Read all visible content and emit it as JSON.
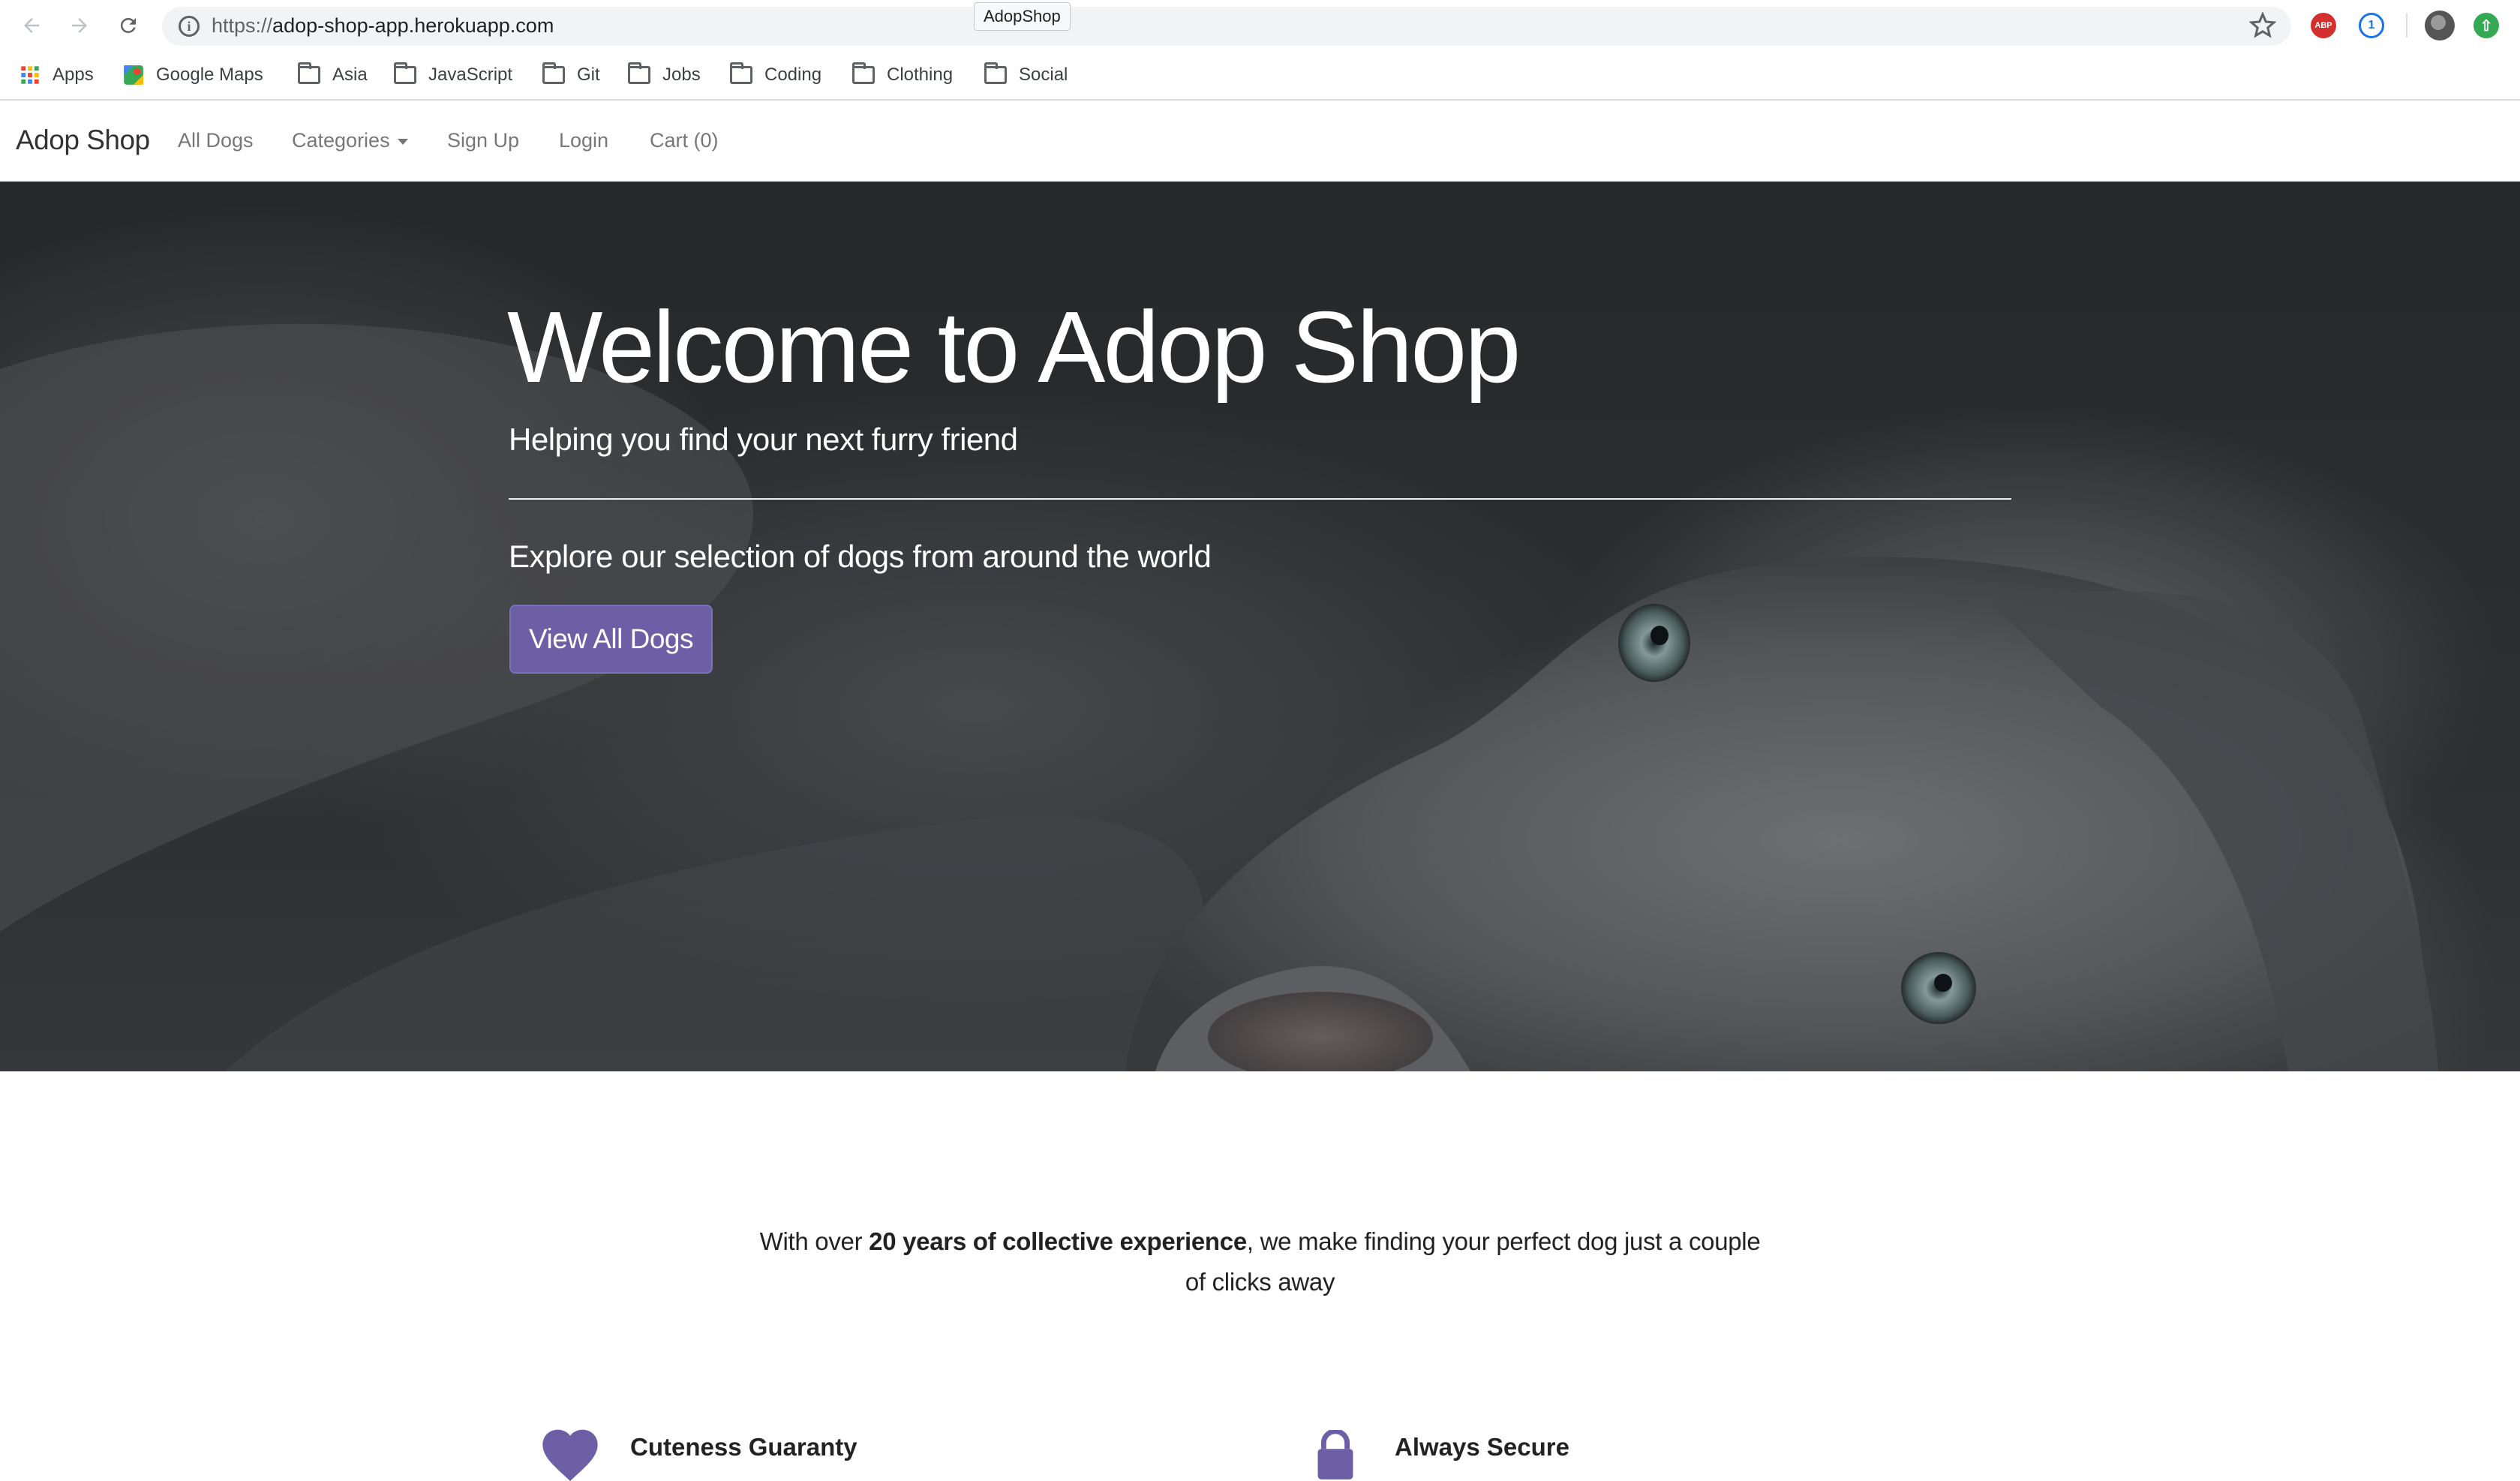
{
  "browser": {
    "tab_tooltip": "AdopShop",
    "url_protocol": "https://",
    "url_host": "adop-shop-app.herokuapp.com",
    "extensions": {
      "abp": "ABP",
      "onepassword": "1"
    }
  },
  "bookmarks": [
    {
      "label": "Apps",
      "icon": "apps-grid-icon"
    },
    {
      "label": "Google Maps",
      "icon": "google-maps-icon"
    },
    {
      "label": "Asia",
      "icon": "folder-icon"
    },
    {
      "label": "JavaScript",
      "icon": "folder-icon"
    },
    {
      "label": "Git",
      "icon": "folder-icon"
    },
    {
      "label": "Jobs",
      "icon": "folder-icon"
    },
    {
      "label": "Coding",
      "icon": "folder-icon"
    },
    {
      "label": "Clothing",
      "icon": "folder-icon"
    },
    {
      "label": "Social",
      "icon": "folder-icon"
    }
  ],
  "navbar": {
    "brand": "Adop Shop",
    "links": [
      "All Dogs",
      "Categories",
      "Sign Up",
      "Login",
      "Cart (0)"
    ]
  },
  "hero": {
    "title": "Welcome to Adop Shop",
    "subtitle": "Helping you find your next furry friend",
    "explore": "Explore our selection of dogs from around the world",
    "button": "View All Dogs"
  },
  "intro": {
    "prefix": "With over ",
    "highlight": "20 years of collective experience",
    "suffix": ", we make finding your perfect dog just a couple of clicks away"
  },
  "features": [
    {
      "title": "Cuteness Guaranty",
      "icon": "heart-icon"
    },
    {
      "title": "Always Secure",
      "icon": "lock-icon"
    }
  ],
  "colors": {
    "accent": "#6c5fa6",
    "icon_purple": "#6c5fa6"
  }
}
